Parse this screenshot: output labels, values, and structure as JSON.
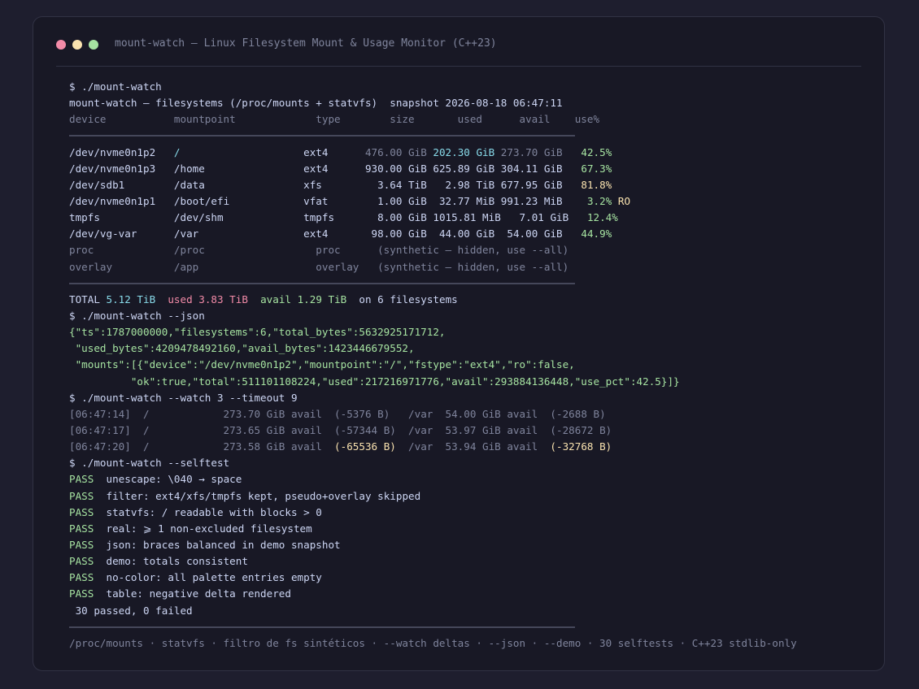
{
  "window": {
    "title": "mount-watch — Linux Filesystem Mount & Usage Monitor (C++23)"
  },
  "cmd1": "$ ./mount-watch",
  "header": "mount-watch — filesystems (/proc/mounts + statvfs)  snapshot 2026-08-18 06:47:11",
  "columns": "device           mountpoint             type        size       used      avail    use%",
  "rows": [
    {
      "device": "/dev/nvme0n1p2  ",
      "mount": " /                    ",
      "type": "ext4      ",
      "size": "476.00 GiB ",
      "used": "202.30 GiB",
      "avail": " 273.70 GiB ",
      "pct": "  42.5%",
      "flag": ""
    },
    {
      "device": "/dev/nvme0n1p3  ",
      "mount": " /home                ",
      "type": "ext4      ",
      "size": "930.00 GiB ",
      "used": "625.89 GiB",
      "avail": " 304.11 GiB ",
      "pct": "  67.3%",
      "flag": ""
    },
    {
      "device": "/dev/sdb1       ",
      "mount": " /data                ",
      "type": "xfs       ",
      "size": "  3.64 TiB ",
      "used": "  2.98 TiB",
      "avail": " 677.95 GiB ",
      "pct": "  81.8%",
      "flag": ""
    },
    {
      "device": "/dev/nvme0n1p1  ",
      "mount": " /boot/efi            ",
      "type": "vfat      ",
      "size": "  1.00 GiB ",
      "used": " 32.77 MiB",
      "avail": " 991.23 MiB ",
      "pct": "   3.2%",
      "flag": " RO"
    },
    {
      "device": "tmpfs           ",
      "mount": " /dev/shm             ",
      "type": "tmpfs     ",
      "size": "  8.00 GiB ",
      "used": "1015.81 MiB",
      "avail": "   7.01 GiB ",
      "pct": "  12.4%",
      "flag": ""
    },
    {
      "device": "/dev/vg-var     ",
      "mount": " /var                 ",
      "type": "ext4      ",
      "size": " 98.00 GiB ",
      "used": " 44.00 GiB",
      "avail": "  54.00 GiB ",
      "pct": "  44.9%",
      "flag": ""
    }
  ],
  "synthetic": [
    "proc             /proc                  proc      (synthetic — hidden, use --all)",
    "overlay          /app                   overlay   (synthetic — hidden, use --all)"
  ],
  "total": {
    "label": "TOTAL ",
    "size": "5.12 TiB",
    "used_label": "  used ",
    "used": "3.83 TiB",
    "avail_label": "  avail ",
    "avail": "1.29 TiB",
    "count": "  on 6 filesystems"
  },
  "cmd2": "$ ./mount-watch --json",
  "json": [
    "{\"ts\":1787000000,\"filesystems\":6,\"total_bytes\":5632925171712,",
    " \"used_bytes\":4209478492160,\"avail_bytes\":1423446679552,",
    " \"mounts\":[{\"device\":\"/dev/nvme0n1p2\",\"mountpoint\":\"/\",\"fstype\":\"ext4\",\"ro\":false,",
    "          \"ok\":true,\"total\":511101108224,\"used\":217216971776,\"avail\":293884136448,\"use_pct\":42.5}]}"
  ],
  "cmd3": "$ ./mount-watch --watch 3 --timeout 9",
  "watch": [
    {
      "a": "[06:47:14]  /            273.70 GiB avail  ",
      "b": "(-5376 B)",
      "c": "   /var  54.00 GiB avail  ",
      "d": "(-2688 B)",
      "hl": false
    },
    {
      "a": "[06:47:17]  /            273.65 GiB avail  ",
      "b": "(-57344 B)",
      "c": "  /var  53.97 GiB avail  ",
      "d": "(-28672 B)",
      "hl": false
    },
    {
      "a": "[06:47:20]  /            273.58 GiB avail  ",
      "b": "(-65536 B)",
      "c": "  /var  53.94 GiB avail  ",
      "d": "(-32768 B)",
      "hl": true
    }
  ],
  "cmd4": "$ ./mount-watch --selftest",
  "tests": [
    {
      "status": "PASS",
      "text": "  unescape: \\040 → space"
    },
    {
      "status": "PASS",
      "text": "  filter: ext4/xfs/tmpfs kept, pseudo+overlay skipped"
    },
    {
      "status": "PASS",
      "text": "  statvfs: / readable with blocks > 0"
    },
    {
      "status": "PASS",
      "text": "  real: ⩾ 1 non-excluded filesystem"
    },
    {
      "status": "PASS",
      "text": "  json: braces balanced in demo snapshot"
    },
    {
      "status": "PASS",
      "text": "  demo: totals consistent"
    },
    {
      "status": "PASS",
      "text": "  no-color: all palette entries empty"
    },
    {
      "status": "PASS",
      "text": "  table: negative delta rendered"
    }
  ],
  "summary": " 30 passed, 0 failed",
  "footer": "/proc/mounts · statvfs · filtro de fs sintéticos · --watch deltas · --json · --demo · 30 selftests · C++23 stdlib-only"
}
